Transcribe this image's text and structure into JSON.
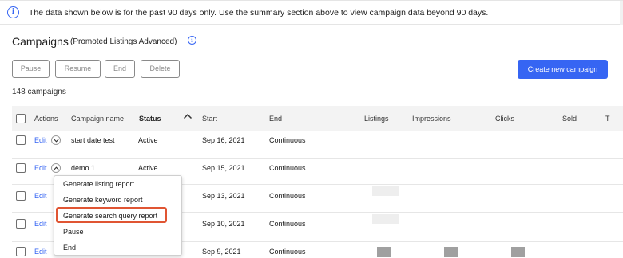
{
  "banner": {
    "message": "The data shown below is for the past 90 days only. Use the summary section above to view campaign data beyond 90 days.",
    "icon": "info-icon"
  },
  "page": {
    "title": "Campaigns",
    "subtitle": "(Promoted Listings Advanced)",
    "info_icon": "info-icon"
  },
  "toolbar": {
    "pause": "Pause",
    "resume": "Resume",
    "end": "End",
    "delete": "Delete",
    "create": "Create new campaign"
  },
  "campaign_count": "148 campaigns",
  "table": {
    "columns": {
      "actions": "Actions",
      "campaign_name": "Campaign name",
      "status": "Status",
      "start": "Start",
      "end": "End",
      "listings": "Listings",
      "impressions": "Impressions",
      "clicks": "Clicks",
      "sold": "Sold",
      "more": "T"
    },
    "sort": {
      "column": "Status",
      "direction": "ascending",
      "icon": "chevron-up-icon"
    },
    "rows": [
      {
        "edit": "Edit",
        "name": "start date test",
        "status": "Active",
        "start": "Sep 16, 2021",
        "end": "Continuous"
      },
      {
        "edit": "Edit",
        "name": "demo 1",
        "status": "Active",
        "start": "Sep 15, 2021",
        "end": "Continuous"
      },
      {
        "edit": "Edit",
        "name": "",
        "status": "",
        "start": "Sep 13, 2021",
        "end": "Continuous"
      },
      {
        "edit": "Edit",
        "name": "",
        "status": "",
        "start": "Sep 10, 2021",
        "end": "Continuous"
      },
      {
        "edit": "Edit",
        "name": "",
        "status": "",
        "start": "Sep 9, 2021",
        "end": "Continuous"
      }
    ]
  },
  "actions_menu": {
    "items": [
      "Generate listing report",
      "Generate keyword report",
      "Generate search query report",
      "Pause",
      "End"
    ],
    "highlighted": "Generate search query report"
  },
  "colors": {
    "accent": "#3665f3",
    "highlight_border": "#e05533",
    "header_bg": "#f3f3f3"
  }
}
